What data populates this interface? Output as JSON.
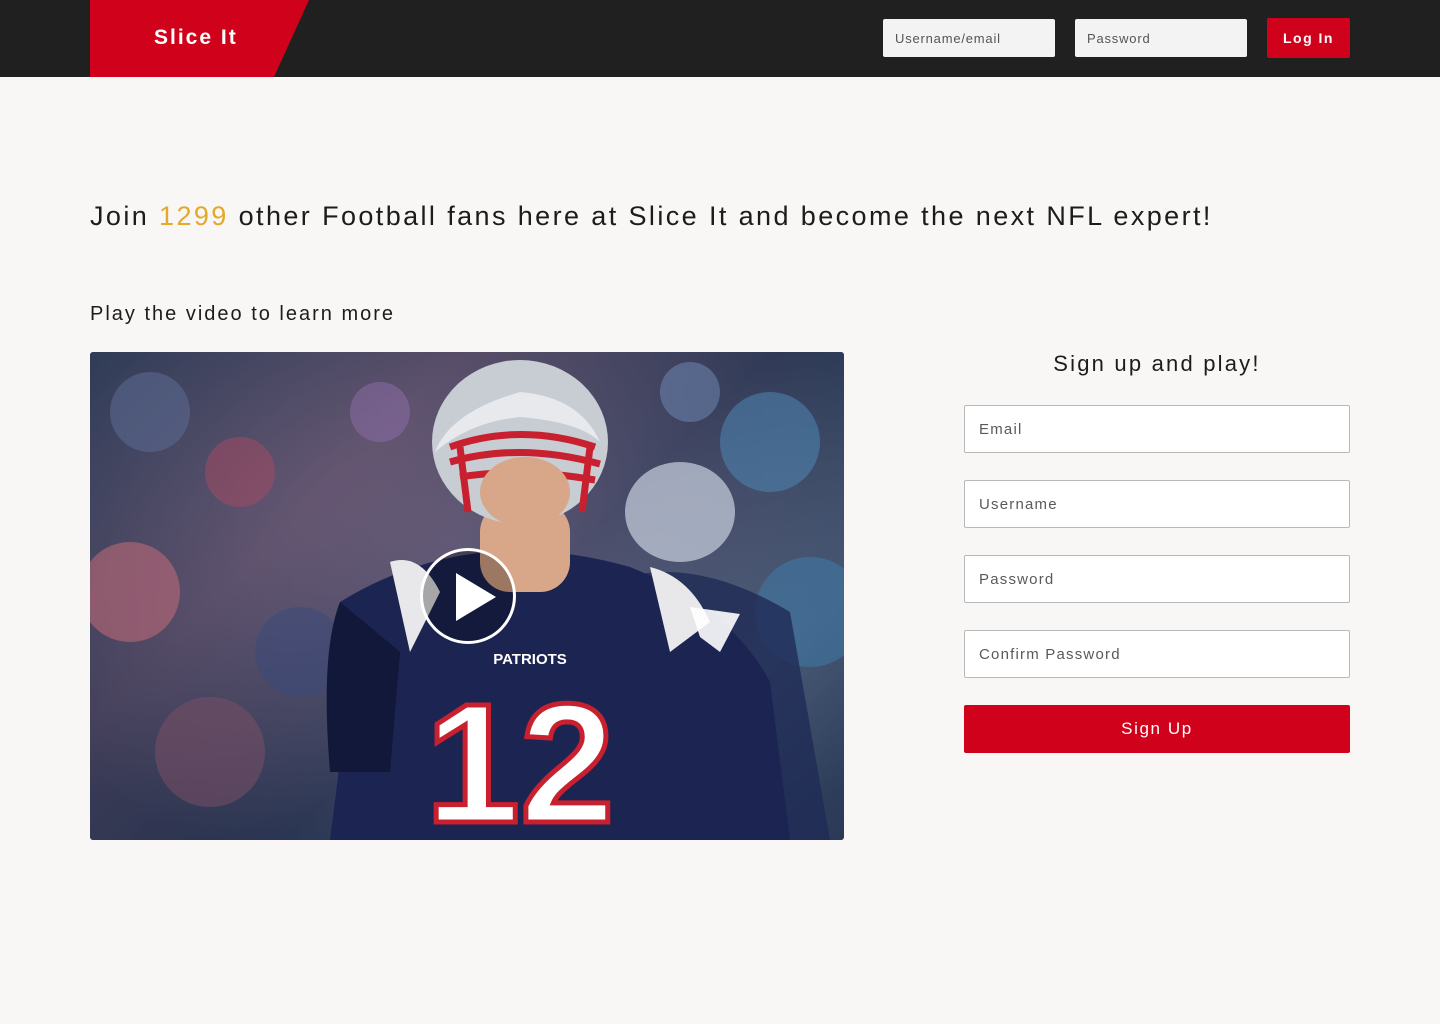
{
  "header": {
    "logo_text": "Slice It",
    "username_placeholder": "Username/email",
    "password_placeholder": "Password",
    "login_label": "Log In"
  },
  "hero": {
    "headline_prefix": "Join ",
    "member_count": "1299",
    "headline_suffix": " other Football fans here at Slice It and become the next NFL expert!",
    "video_prompt": "Play the video to learn more"
  },
  "video": {
    "jersey_number": "12",
    "jersey_text": "PATRIOTS"
  },
  "signup": {
    "title": "Sign up and play!",
    "email_placeholder": "Email",
    "username_placeholder": "Username",
    "password_placeholder": "Password",
    "confirm_placeholder": "Confirm Password",
    "button_label": "Sign Up"
  },
  "colors": {
    "brand_red": "#d0021b",
    "count_accent": "#e5a82a",
    "header_bg": "#202020",
    "page_bg": "#f8f7f5"
  }
}
